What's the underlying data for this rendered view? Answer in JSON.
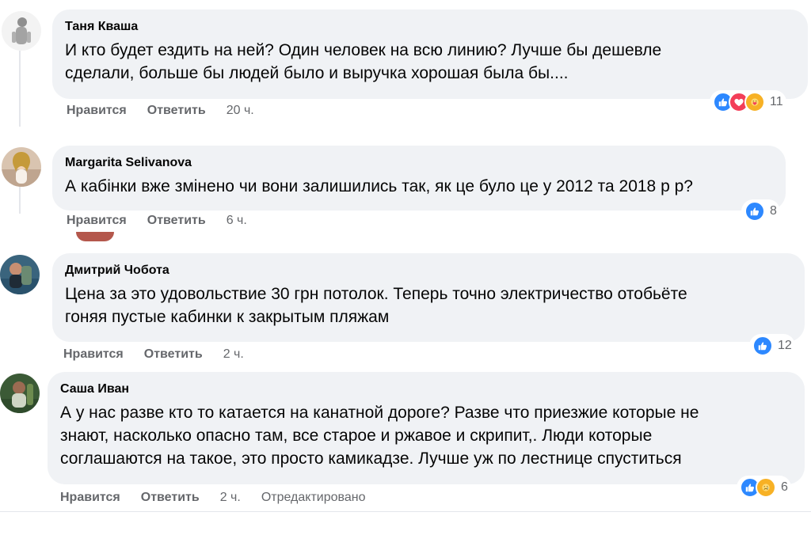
{
  "comments": [
    {
      "author": "Таня Кваша",
      "text_lines": [
        "И кто будет ездить на ней? Один человек на всю линию? Лучше бы дешевле",
        "сделали, больше бы людей было и выручка хорошая была бы...."
      ],
      "like_label": "Нравится",
      "reply_label": "Ответить",
      "time": "20 ч.",
      "reaction_icons": [
        "like-icon",
        "love-icon",
        "care-icon"
      ],
      "reaction_count": "11"
    },
    {
      "author": "Margarita Selivanova",
      "text_lines": [
        "А кабінки вже змінено чи вони залишились так, як це було це у 2012 та 2018 р р?"
      ],
      "like_label": "Нравится",
      "reply_label": "Ответить",
      "time": "6 ч.",
      "reaction_icons": [
        "like-icon"
      ],
      "reaction_count": "8"
    },
    {
      "author": "Дмитрий Чобота",
      "text_lines": [
        "Цена за это удовольствие 30 грн потолок. Теперь точно электричество отобьёте",
        "гоняя пустые кабинки к закрытым пляжам"
      ],
      "like_label": "Нравится",
      "reply_label": "Ответить",
      "time": "2 ч.",
      "reaction_icons": [
        "like-icon"
      ],
      "reaction_count": "12"
    },
    {
      "author": "Саша Иван",
      "text_lines": [
        "А у нас разве кто то катается на канатной дороге? Разве что приезжие которые не",
        "знают, насколько опасно там, все старое и ржавое и скрипит,. Люди которые",
        "соглашаются на такое, это просто камикадзе. Лучше уж по лестнице спуститься"
      ],
      "like_label": "Нравится",
      "reply_label": "Ответить",
      "time": "2 ч.",
      "edited_label": "Отредактировано",
      "reaction_icons": [
        "like-icon",
        "sad-icon"
      ],
      "reaction_count": "6"
    }
  ],
  "colors": {
    "bubble_bg": "#f0f2f5",
    "meta_text": "#65676b",
    "like": "#2d88ff",
    "love": "#f33e58",
    "care": "#f7b125",
    "sad": "#f7b125"
  }
}
